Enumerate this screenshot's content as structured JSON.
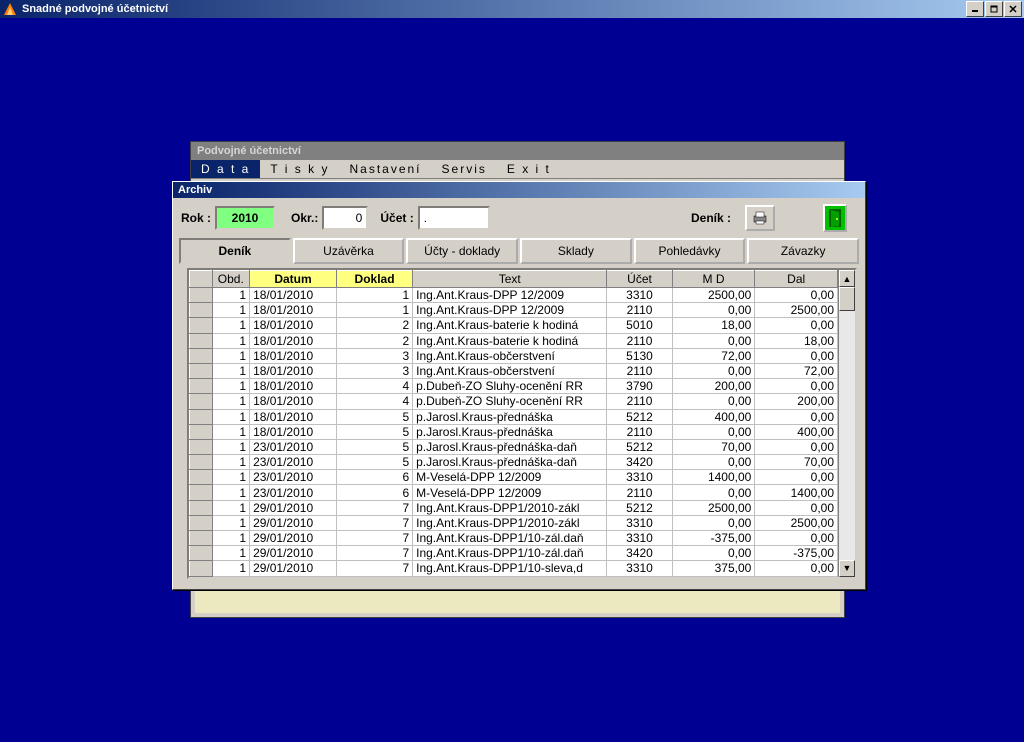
{
  "main_window": {
    "title": "Snadné podvojné účetnictví"
  },
  "parent_window": {
    "title": "Podvojné účetnictví",
    "menu": [
      "D a t a",
      "T i s k y",
      "Nastavení",
      "Servis",
      "E x i t"
    ]
  },
  "archiv": {
    "title": "Archiv",
    "filters": {
      "rok_label": "Rok :",
      "rok_value": "2010",
      "okr_label": "Okr.:",
      "okr_value": "0",
      "ucet_label": "Účet :",
      "ucet_value": ".",
      "denik_label": "Deník :"
    },
    "tabs": [
      "Deník",
      "Uzávěrka",
      "Účty - doklady",
      "Sklady",
      "Pohledávky",
      "Závazky"
    ],
    "columns": [
      "Obd.",
      "Datum",
      "Doklad",
      "Text",
      "Účet",
      "M D",
      "Dal"
    ],
    "rows": [
      {
        "obd": "1",
        "datum": "18/01/2010",
        "doklad": "1",
        "text": "Ing.Ant.Kraus-DPP 12/2009",
        "ucet": "3310",
        "md": "2500,00",
        "dal": "0,00"
      },
      {
        "obd": "1",
        "datum": "18/01/2010",
        "doklad": "1",
        "text": "Ing.Ant.Kraus-DPP 12/2009",
        "ucet": "2110",
        "md": "0,00",
        "dal": "2500,00"
      },
      {
        "obd": "1",
        "datum": "18/01/2010",
        "doklad": "2",
        "text": "Ing.Ant.Kraus-baterie k hodiná",
        "ucet": "5010",
        "md": "18,00",
        "dal": "0,00"
      },
      {
        "obd": "1",
        "datum": "18/01/2010",
        "doklad": "2",
        "text": "Ing.Ant.Kraus-baterie k hodiná",
        "ucet": "2110",
        "md": "0,00",
        "dal": "18,00"
      },
      {
        "obd": "1",
        "datum": "18/01/2010",
        "doklad": "3",
        "text": "Ing.Ant.Kraus-občerstvení",
        "ucet": "5130",
        "md": "72,00",
        "dal": "0,00"
      },
      {
        "obd": "1",
        "datum": "18/01/2010",
        "doklad": "3",
        "text": "Ing.Ant.Kraus-občerstvení",
        "ucet": "2110",
        "md": "0,00",
        "dal": "72,00"
      },
      {
        "obd": "1",
        "datum": "18/01/2010",
        "doklad": "4",
        "text": "p.Dubeň-ZO Sluhy-ocenění RR",
        "ucet": "3790",
        "md": "200,00",
        "dal": "0,00"
      },
      {
        "obd": "1",
        "datum": "18/01/2010",
        "doklad": "4",
        "text": "p.Dubeň-ZO Sluhy-ocenění RR",
        "ucet": "2110",
        "md": "0,00",
        "dal": "200,00"
      },
      {
        "obd": "1",
        "datum": "18/01/2010",
        "doklad": "5",
        "text": "p.Jarosl.Kraus-přednáška",
        "ucet": "5212",
        "md": "400,00",
        "dal": "0,00"
      },
      {
        "obd": "1",
        "datum": "18/01/2010",
        "doklad": "5",
        "text": "p.Jarosl.Kraus-přednáška",
        "ucet": "2110",
        "md": "0,00",
        "dal": "400,00"
      },
      {
        "obd": "1",
        "datum": "23/01/2010",
        "doklad": "5",
        "text": "p.Jarosl.Kraus-přednáška-daň",
        "ucet": "5212",
        "md": "70,00",
        "dal": "0,00"
      },
      {
        "obd": "1",
        "datum": "23/01/2010",
        "doklad": "5",
        "text": "p.Jarosl.Kraus-přednáška-daň",
        "ucet": "3420",
        "md": "0,00",
        "dal": "70,00"
      },
      {
        "obd": "1",
        "datum": "23/01/2010",
        "doklad": "6",
        "text": "M-Veselá-DPP 12/2009",
        "ucet": "3310",
        "md": "1400,00",
        "dal": "0,00"
      },
      {
        "obd": "1",
        "datum": "23/01/2010",
        "doklad": "6",
        "text": "M-Veselá-DPP 12/2009",
        "ucet": "2110",
        "md": "0,00",
        "dal": "1400,00"
      },
      {
        "obd": "1",
        "datum": "29/01/2010",
        "doklad": "7",
        "text": "Ing.Ant.Kraus-DPP1/2010-zákl",
        "ucet": "5212",
        "md": "2500,00",
        "dal": "0,00"
      },
      {
        "obd": "1",
        "datum": "29/01/2010",
        "doklad": "7",
        "text": "Ing.Ant.Kraus-DPP1/2010-zákl",
        "ucet": "3310",
        "md": "0,00",
        "dal": "2500,00"
      },
      {
        "obd": "1",
        "datum": "29/01/2010",
        "doklad": "7",
        "text": "Ing.Ant.Kraus-DPP1/10-zál.daň",
        "ucet": "3310",
        "md": "-375,00",
        "dal": "0,00"
      },
      {
        "obd": "1",
        "datum": "29/01/2010",
        "doklad": "7",
        "text": "Ing.Ant.Kraus-DPP1/10-zál.daň",
        "ucet": "3420",
        "md": "0,00",
        "dal": "-375,00"
      },
      {
        "obd": "1",
        "datum": "29/01/2010",
        "doklad": "7",
        "text": "Ing.Ant.Kraus-DPP1/10-sleva,d",
        "ucet": "3310",
        "md": "375,00",
        "dal": "0,00"
      }
    ]
  }
}
